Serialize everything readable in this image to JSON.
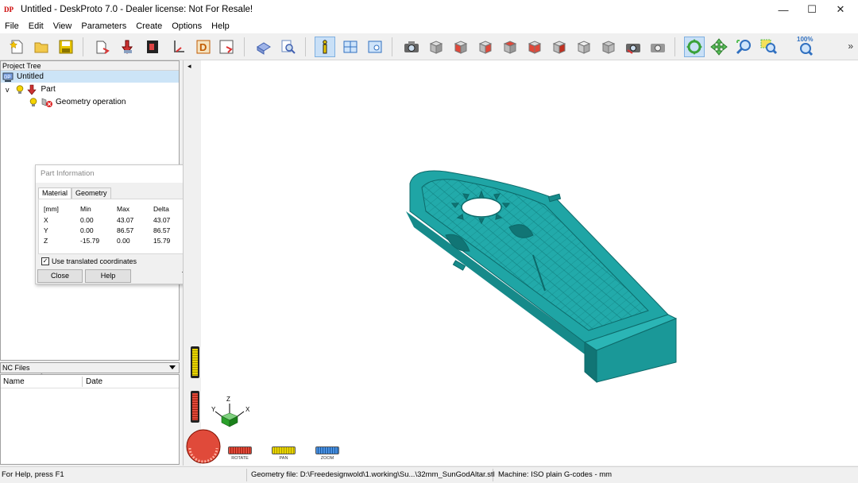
{
  "window": {
    "title": "Untitled - DeskProto 7.0 - Dealer license: Not For Resale!",
    "icon_text": "DP",
    "minimize_glyph": "—",
    "maximize_glyph": "☐",
    "close_glyph": "✕"
  },
  "menu": [
    "File",
    "Edit",
    "View",
    "Parameters",
    "Create",
    "Options",
    "Help"
  ],
  "toolbar": {
    "zoom_100_label": "100%",
    "more_glyph": "»",
    "buttons": [
      "new-project-icon",
      "open-project-icon",
      "save-project-icon",
      "load-part-icon",
      "load-part-special-icon",
      "load-bitmap-icon",
      "load-vector-icon",
      "delete-part-icon",
      "save-part-icon",
      "part-parameters-icon",
      "find-icon",
      "info-icon",
      "layout-icon",
      "view-window-icon",
      "camera-icon",
      "view-front-icon",
      "view-back-icon",
      "view-left-icon",
      "view-right-icon",
      "view-top-icon",
      "view-bottom-icon",
      "view-iso-icon",
      "view-iso-2-icon",
      "screenshot-icon",
      "screenshot-2-icon",
      "rotate-icon",
      "pan-icon",
      "zoom-icon",
      "zoom-window-icon",
      "zoom-100-icon"
    ]
  },
  "project_tree": {
    "header": "Project Tree",
    "items": [
      {
        "label": "Untitled",
        "selected": true
      },
      {
        "label": "Part",
        "expand_glyph": "v"
      },
      {
        "label": "Geometry operation"
      }
    ]
  },
  "part_info": {
    "title": "Part Information",
    "tabs": [
      "Material",
      "Geometry"
    ],
    "active_tab": "Material",
    "columns": [
      "[mm]",
      "Min",
      "Max",
      "Delta"
    ],
    "rows": [
      {
        "axis": "X",
        "min": "0.00",
        "max": "43.07",
        "delta": "43.07"
      },
      {
        "axis": "Y",
        "min": "0.00",
        "max": "86.57",
        "delta": "86.57"
      },
      {
        "axis": "Z",
        "min": "-15.79",
        "max": "0.00",
        "delta": "15.79"
      }
    ],
    "checkbox_label": "Use translated coordinates",
    "checkbox_checked": true,
    "check_glyph": "✓",
    "close_label": "Close",
    "help_label": "Help"
  },
  "nc_files": {
    "header": "NC Files",
    "columns": [
      "Name",
      "Date"
    ]
  },
  "viewport": {
    "collapse_glyph": "◂",
    "axes": {
      "x": "X",
      "y": "Y",
      "z": "Z"
    },
    "controls": [
      {
        "label": "ROTATE",
        "color": "#e04a3a"
      },
      {
        "label": "PAN",
        "color": "#e8d400"
      },
      {
        "label": "ZOOM",
        "color": "#4a90e0"
      }
    ],
    "model_color": "#1fa5a5"
  },
  "status": {
    "help": "For Help, press F1",
    "geometry_file": "Geometry file: D:\\Freedesignwold\\1.working\\Su...\\32mm_SunGodAltar.stl",
    "machine": "Machine: ISO plain G-codes - mm"
  }
}
